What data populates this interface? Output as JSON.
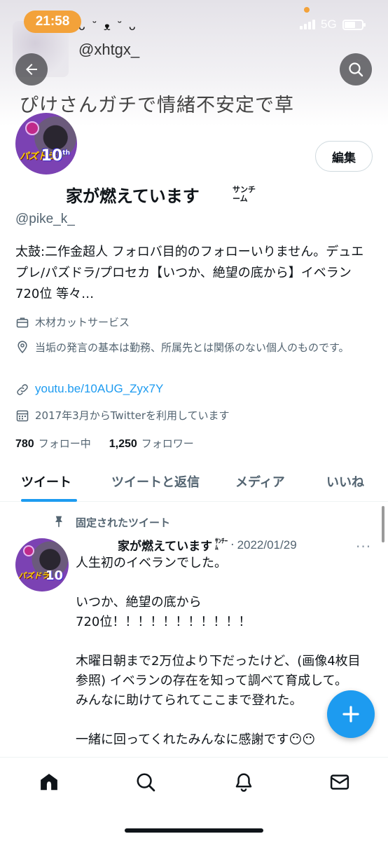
{
  "status_bar": {
    "time": "21:58",
    "network": "5G"
  },
  "banner": {
    "emote": "ᴗ ˘ ᴥ ˘ ᴗ",
    "handle_text": "@xhtgx_",
    "overlay_text": "ぴけさんガチで情緒不安定で草"
  },
  "header": {
    "back_icon": "arrow-left-icon",
    "search_icon": "search-icon"
  },
  "profile": {
    "avatar_text": "パズドラ",
    "avatar_number": "10",
    "avatar_number_suffix": "th",
    "edit_label": "編集",
    "display_name": "家が燃えています",
    "name_suffix": "サンチーム",
    "handle": "@pike_k_",
    "bio": "太鼓:二作金超人 フォロバ目的のフォローいりません。デュエプレ/パズドラ/プロセカ【いつか、絶望の底から】イベラン720位 等々…",
    "job": "木材カットサービス",
    "location": "当垢の発言の基本は勤務、所属先とは関係のない個人のものです。",
    "link": "youtu.be/10AUG_Zyx7Y",
    "joined": "2017年3月からTwitterを利用しています",
    "following_count": "780",
    "following_label": "フォロー中",
    "followers_count": "1,250",
    "followers_label": "フォロワー"
  },
  "tabs": [
    {
      "label": "ツイート",
      "active": true
    },
    {
      "label": "ツイートと返信",
      "active": false
    },
    {
      "label": "メディア",
      "active": false
    },
    {
      "label": "いいね",
      "active": false
    }
  ],
  "pinned_tweet": {
    "pinned_label": "固定されたツイート",
    "author_name": "家が燃えています",
    "author_suffix": "ｻﾝﾁｰﾑ",
    "separator": "·",
    "date": "2022/01/29",
    "more": "···",
    "body": "人生初のイベランでした。\n\nいつか、絶望の底から\n720位！！！！！！！！！！！\n\n木曜日朝まで2万位より下だったけど、(画像4枚目参照) イベランの存在を知って調べて育成して。\nみんなに助けてられてここまで登れた。\n\n一緒に回ってくれたみんなに感謝です😶😶"
  },
  "fab": {
    "icon": "plus-icon"
  },
  "bottom_nav": [
    {
      "icon": "home-icon"
    },
    {
      "icon": "search-icon"
    },
    {
      "icon": "bell-icon"
    },
    {
      "icon": "mail-icon"
    }
  ],
  "colors": {
    "accent": "#1d9bf0",
    "status_pill": "#f3a23a",
    "text": "#0f1419",
    "muted": "#536471"
  }
}
